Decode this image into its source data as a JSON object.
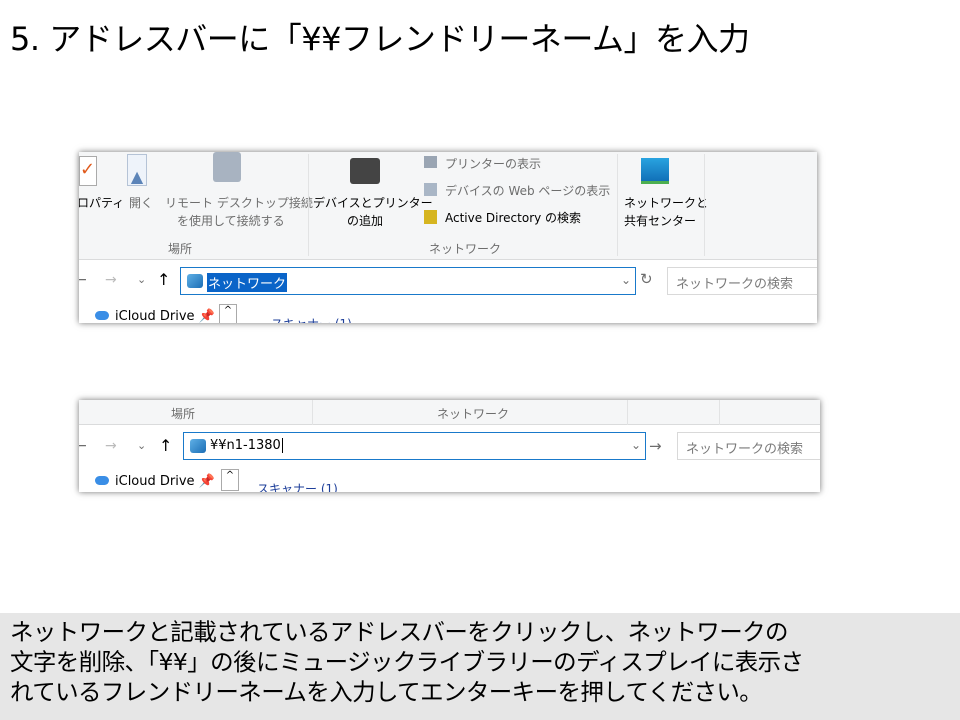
{
  "title": "5. アドレスバーに「¥¥フレンドリーネーム」を入力",
  "shot1": {
    "ribbon": {
      "properties": "ロパティ",
      "open": "開く",
      "remote_line1": "リモート デスクトップ接続",
      "remote_line2": "を使用して接続する",
      "group_location": "場所",
      "add_device_line1": "デバイスとプリンター",
      "add_device_line2": "の追加",
      "show_printers": "プリンターの表示",
      "device_web": "デバイスの Web ページの表示",
      "ad_search": "Active Directory の検索",
      "group_network": "ネットワーク",
      "net_center_line1": "ネットワークと",
      "net_center_line2": "共有センター"
    },
    "address_value": "ネットワーク",
    "search_placeholder": "ネットワークの検索",
    "nav_item": "iCloud Drive",
    "section": "スキャナー (1)"
  },
  "shot2": {
    "group_location": "場所",
    "group_network": "ネットワーク",
    "address_value": "¥¥n1-1380",
    "search_placeholder": "ネットワークの検索",
    "nav_item": "iCloud Drive",
    "section": "スキャナー (1)"
  },
  "caption": [
    "ネットワークと記載されているアドレスバーをクリックし、ネットワークの",
    "文字を削除、「¥¥」の後にミュージックライブラリーのディスプレイに表示さ",
    "れているフレンドリーネームを入力してエンターキーを押してください。"
  ]
}
